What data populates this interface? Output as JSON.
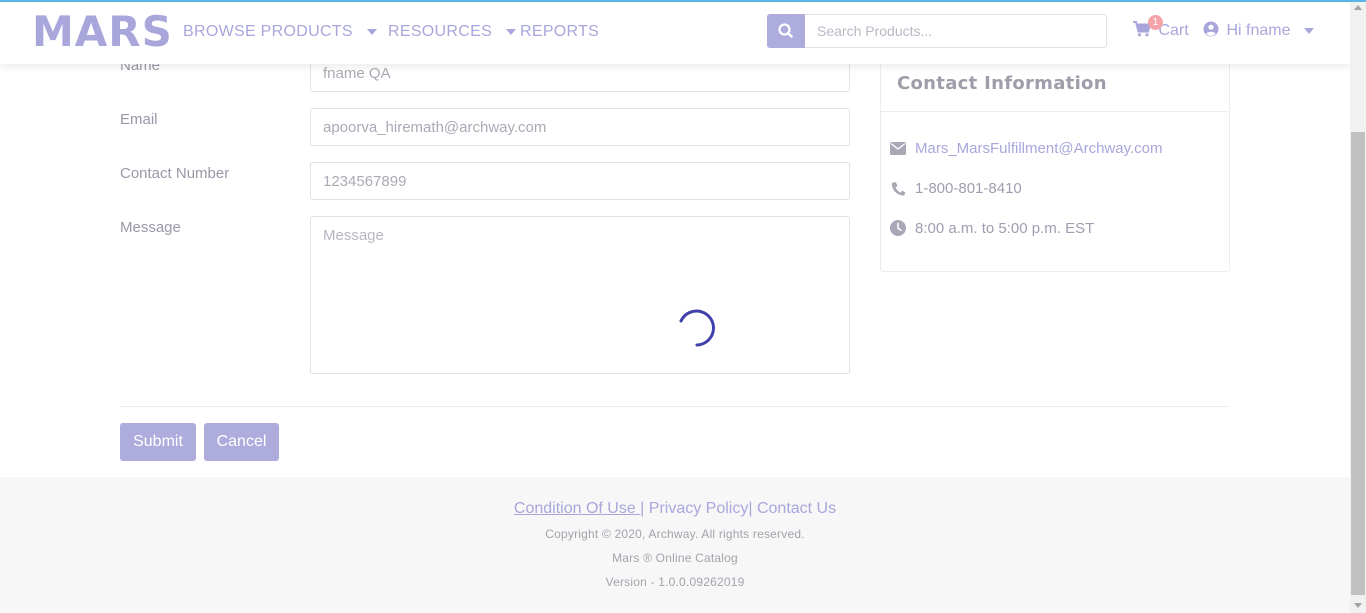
{
  "brand": {
    "logo": "MARS"
  },
  "nav": {
    "items": [
      {
        "label": "BROWSE PRODUCTS",
        "has_dropdown": true
      },
      {
        "label": "RESOURCES",
        "has_dropdown": true
      },
      {
        "label": "REPORTS",
        "has_dropdown": false
      }
    ],
    "search_placeholder": "Search Products...",
    "cart_label": "Cart",
    "cart_count": "1",
    "user_greeting": "Hi fname"
  },
  "form": {
    "name_label": "Name",
    "name_value": "fname QA",
    "email_label": "Email",
    "email_value": "apoorva_hiremath@archway.com",
    "contact_label": "Contact Number",
    "contact_value": "1234567899",
    "message_label": "Message",
    "message_placeholder": "Message",
    "submit_label": "Submit",
    "cancel_label": "Cancel"
  },
  "contact_info": {
    "title": "Contact Information",
    "email": "Mars_MarsFulfillment@Archway.com",
    "phone": "1-800-801-8410",
    "hours": "8:00 a.m. to 5:00 p.m. EST"
  },
  "footer": {
    "condition_of_use": "Condition Of Use ",
    "privacy_policy": "Privacy Policy",
    "contact_us": " Contact Us",
    "separator": "|",
    "copyright": "Copyright © 2020, Archway. All rights reserved.",
    "catalog": "Mars ® Online Catalog",
    "version": "Version - 1.0.0.09262019"
  },
  "colors": {
    "accent": "#aeabdd",
    "link": "#a9a6dc",
    "spinner": "#3f3fae",
    "badge": "#f5a3a8",
    "top_line": "#5ab4e6"
  },
  "icons": [
    "search-icon",
    "cart-icon",
    "user-circle-icon",
    "chevron-down-icon",
    "envelope-icon",
    "phone-icon",
    "clock-icon",
    "loading-spinner"
  ]
}
